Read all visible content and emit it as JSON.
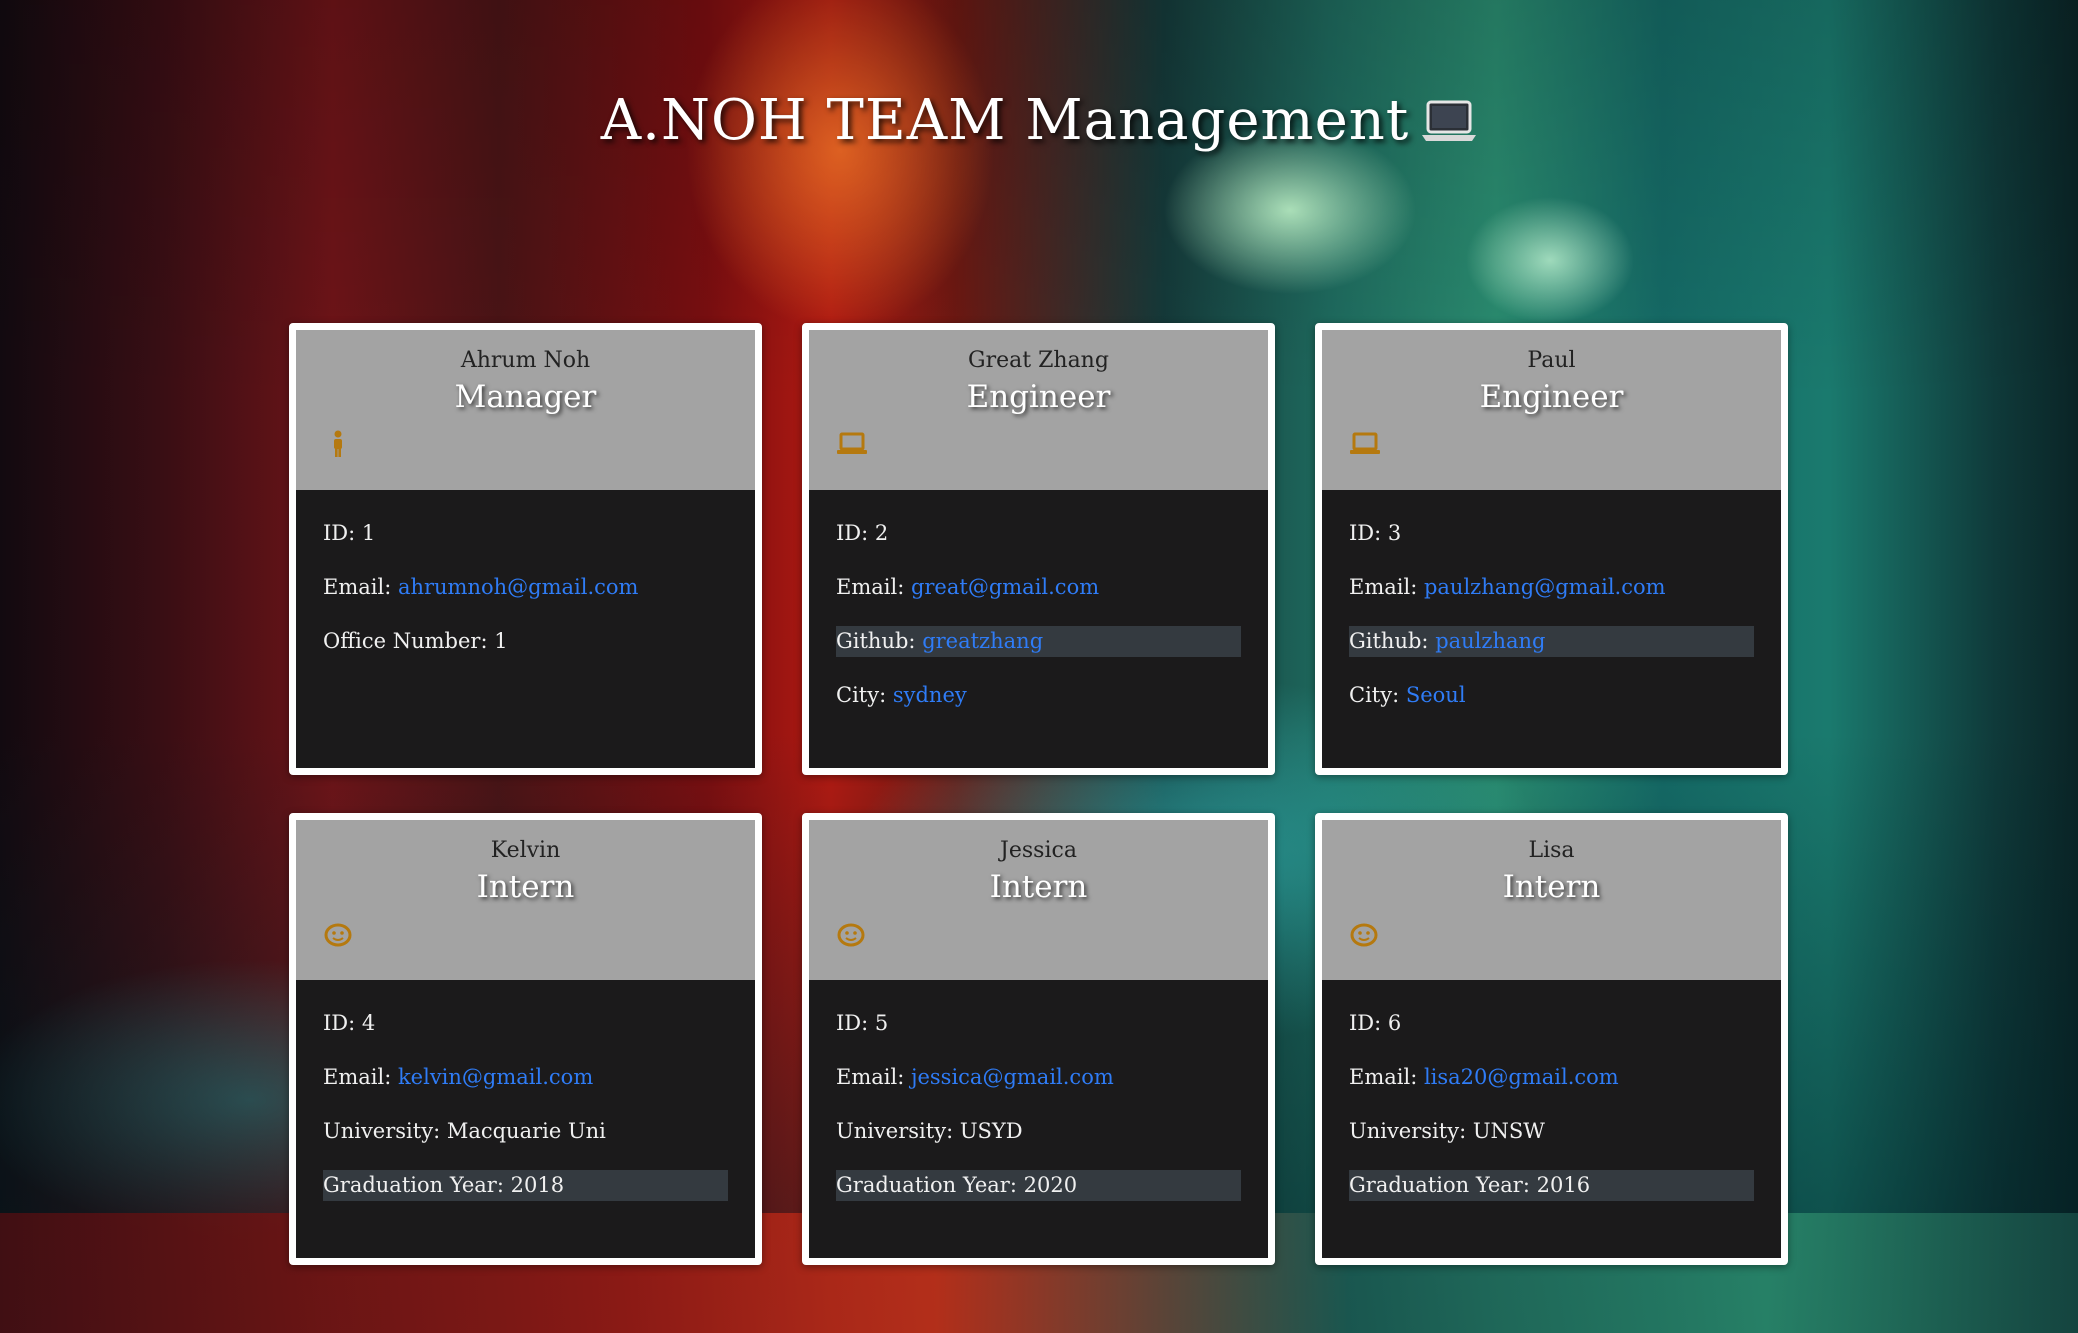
{
  "page": {
    "title": "A.NOH TEAM Management",
    "title_icon": "laptop-icon"
  },
  "colors": {
    "header_bg": "#a3a3a3",
    "body_bg": "#1b1a1b",
    "icon": "#b5790f",
    "link": "#2f7cf6",
    "shaded_row": "#343a40"
  },
  "labels": {
    "id": "ID: ",
    "email": "Email: ",
    "office": "Office Number: ",
    "github": "Github: ",
    "city": "City: ",
    "university": "University: ",
    "graduation": "Graduation Year: "
  },
  "cards": [
    {
      "name": "Ahrum Noh",
      "role": "Manager",
      "icon": "person-icon",
      "id": "1",
      "email": "ahrumnoh@gmail.com",
      "office": "1"
    },
    {
      "name": "Great Zhang",
      "role": "Engineer",
      "icon": "laptop-icon",
      "id": "2",
      "email": "great@gmail.com",
      "github": "greatzhang",
      "city": "sydney"
    },
    {
      "name": "Paul",
      "role": "Engineer",
      "icon": "laptop-icon",
      "id": "3",
      "email": "paulzhang@gmail.com",
      "github": "paulzhang",
      "city": "Seoul"
    },
    {
      "name": "Kelvin",
      "role": "Intern",
      "icon": "smiley-icon",
      "id": "4",
      "email": "kelvin@gmail.com",
      "university": "Macquarie Uni",
      "graduation": "2018"
    },
    {
      "name": "Jessica",
      "role": "Intern",
      "icon": "smiley-icon",
      "id": "5",
      "email": "jessica@gmail.com",
      "university": "USYD",
      "graduation": "2020"
    },
    {
      "name": "Lisa",
      "role": "Intern",
      "icon": "smiley-icon",
      "id": "6",
      "email": "lisa20@gmail.com",
      "university": "UNSW",
      "graduation": "2016"
    }
  ]
}
